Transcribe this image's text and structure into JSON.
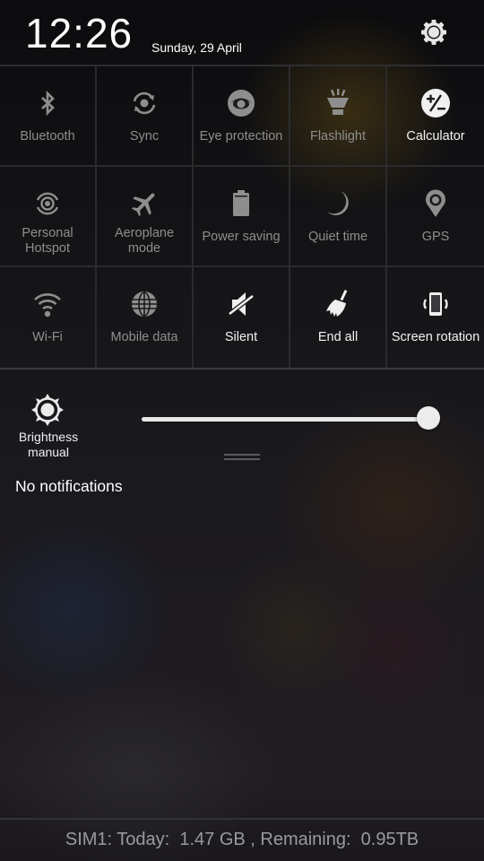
{
  "header": {
    "time": "12:26",
    "date": "Sunday, 29 April",
    "settings_icon": "gear-icon"
  },
  "toggles": [
    {
      "label": "Bluetooth",
      "icon": "bluetooth-icon",
      "state": "off"
    },
    {
      "label": "Sync",
      "icon": "sync-icon",
      "state": "off"
    },
    {
      "label": "Eye protection",
      "icon": "eye-icon",
      "state": "off"
    },
    {
      "label": "Flashlight",
      "icon": "flashlight-icon",
      "state": "off"
    },
    {
      "label": "Calculator",
      "icon": "calculator-icon",
      "state": "on"
    },
    {
      "label": "Personal\nHotspot",
      "icon": "hotspot-icon",
      "state": "off"
    },
    {
      "label": "Aeroplane\nmode",
      "icon": "airplane-icon",
      "state": "off"
    },
    {
      "label": "Power saving",
      "icon": "battery-icon",
      "state": "off"
    },
    {
      "label": "Quiet time",
      "icon": "moon-icon",
      "state": "off"
    },
    {
      "label": "GPS",
      "icon": "location-pin-icon",
      "state": "off"
    },
    {
      "label": "Wi-Fi",
      "icon": "wifi-icon",
      "state": "off"
    },
    {
      "label": "Mobile data",
      "icon": "globe-icon",
      "state": "off"
    },
    {
      "label": "Silent",
      "icon": "speaker-muted-icon",
      "state": "on"
    },
    {
      "label": "End all",
      "icon": "broom-icon",
      "state": "on"
    },
    {
      "label": "Screen rotation",
      "icon": "screen-rotation-icon",
      "state": "on"
    }
  ],
  "brightness": {
    "label": "Brightness\nmanual",
    "icon": "brightness-icon",
    "level_percent": 100
  },
  "notifications": {
    "empty_text": "No notifications"
  },
  "footer": {
    "data_usage": "SIM1: Today:  1.47 GB , Remaining:  0.95TB"
  }
}
